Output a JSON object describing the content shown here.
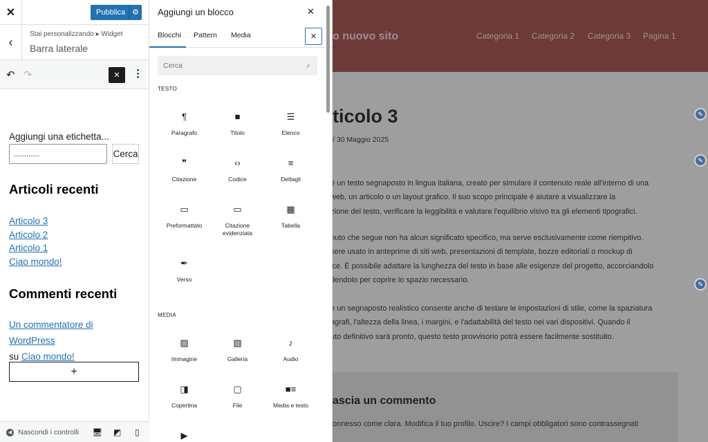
{
  "customizer": {
    "close_label": "✕",
    "publish_label": "Pubblica",
    "breadcrumb": "Stai personalizzando ▸ Widget",
    "section_title": "Barra laterale",
    "toolbar": {
      "undo": "↶",
      "redo": "↷",
      "close": "✕",
      "more": "⋮"
    },
    "widget": {
      "search_label": "Aggiungi una etichetta...",
      "search_value": "............",
      "search_button": "Cerca",
      "recent_posts_title": "Articoli recenti",
      "recent_posts": [
        "Articolo 3",
        "Articolo 2",
        "Articolo 1",
        "Ciao mondo!"
      ],
      "recent_comments_title": "Commenti recenti",
      "comment_author": "Un commentatore di WordPress",
      "comment_on": "su",
      "comment_post": "Ciao mondo!",
      "add_block": "+"
    },
    "footer": {
      "hide_controls": "Nascondi i controlli"
    }
  },
  "inserter": {
    "title": "Aggiungi un blocco",
    "close": "✕",
    "tabs": [
      "Blocchi",
      "Pattern",
      "Media"
    ],
    "search_placeholder": "Cerca",
    "categories": {
      "text": "TESTO",
      "media": "MEDIA"
    },
    "text_blocks": [
      {
        "label": "Paragrafo",
        "icon": "¶"
      },
      {
        "label": "Titolo",
        "icon": "🔖"
      },
      {
        "label": "Elenco",
        "icon": "☰"
      },
      {
        "label": "Citazione",
        "icon": "❞"
      },
      {
        "label": "Codice",
        "icon": "‹›"
      },
      {
        "label": "Dettagli",
        "icon": "≡"
      },
      {
        "label": "Preformattato",
        "icon": "▭"
      },
      {
        "label": "Citazione evidenziata",
        "icon": "▭"
      },
      {
        "label": "Tabella",
        "icon": "▦"
      },
      {
        "label": "Verso",
        "icon": "✒"
      }
    ],
    "media_blocks": [
      {
        "label": "Immagine",
        "icon": "▨"
      },
      {
        "label": "Galleria",
        "icon": "▧"
      },
      {
        "label": "Audio",
        "icon": "♪"
      },
      {
        "label": "Copertina",
        "icon": "◨"
      },
      {
        "label": "File",
        "icon": "▢"
      },
      {
        "label": "Media e testo",
        "icon": "■≡"
      },
      {
        "label": "",
        "icon": "▶"
      }
    ]
  },
  "preview": {
    "site_title": "o nuovo sito",
    "nav": [
      "Categoria 1",
      "Categoria 2",
      "Categoria 3",
      "Pagina 1"
    ],
    "post_title": "ticolo 3",
    "post_date": "/  30 Maggio 2025",
    "paragraphs": [
      [
        " è un testo segnaposto in lingua italiana, creato per simulare il contenuto reale all'interno di una",
        "web, un articolo o un layout grafico. Il suo scopo principale è aiutare a visualizzare la",
        "zione del testo, verificare la leggibilità e valutare l'equilibrio visivo tra gli elementi tipografici."
      ],
      [
        "nuto che segue non ha alcun significato specifico, ma serve esclusivamente come riempitivo.",
        "sere usato in anteprime di siti web, presentazioni di template, bozze editoriali o mockup di",
        "ice. È possibile adattare la lunghezza del testo in base alle esigenze del progetto, accorciandolo",
        "dendolo per coprire lo spazio necessario."
      ],
      [
        "e un segnaposto realistico consente anche di testare le impostazioni di stile, come la spaziatura",
        "agrafi, l'altezza della linea, i margini, e l'adattabilità del testo nei vari dispositivi. Quando il",
        "uto definitivo sarà pronto, questo testo provvisorio potrà essere facilmente sostituito."
      ]
    ],
    "comment_title": "ascia un commento",
    "comment_text": "onnesso come clara. Modifica il tuo profilo. Uscire? I campi obbligatori sono contrassegnati"
  }
}
